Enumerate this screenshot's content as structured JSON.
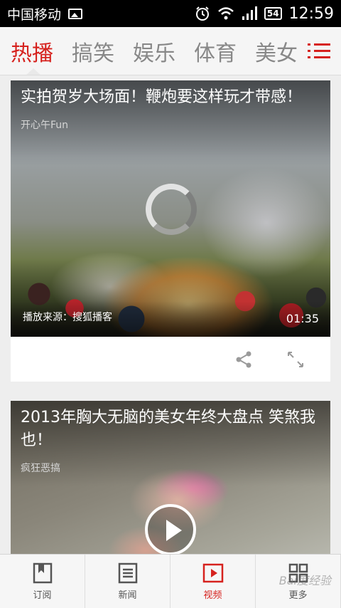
{
  "status_bar": {
    "carrier": "中国移动",
    "battery": "54",
    "time": "12:59"
  },
  "tabs": [
    {
      "label": "热播",
      "active": true
    },
    {
      "label": "搞笑",
      "active": false
    },
    {
      "label": "娱乐",
      "active": false
    },
    {
      "label": "体育",
      "active": false
    },
    {
      "label": "美女",
      "active": false
    }
  ],
  "accent_color": "#d6221e",
  "cards": [
    {
      "title": "实拍贺岁大场面！鞭炮要这样玩才带感！",
      "source": "开心午Fun",
      "play_source": "播放来源：搜狐播客",
      "duration": "01:35",
      "state": "loading"
    },
    {
      "title": "2013年胸大无脑的美女年终大盘点 笑煞我也！",
      "source": "疯狂恶搞",
      "state": "paused"
    }
  ],
  "bottom_nav": [
    {
      "label": "订阅",
      "icon": "bookmark-icon",
      "active": false
    },
    {
      "label": "新闻",
      "icon": "news-icon",
      "active": false
    },
    {
      "label": "视频",
      "icon": "video-icon",
      "active": true
    },
    {
      "label": "更多",
      "icon": "grid-icon",
      "active": false
    }
  ],
  "watermark": "Bai度经验"
}
